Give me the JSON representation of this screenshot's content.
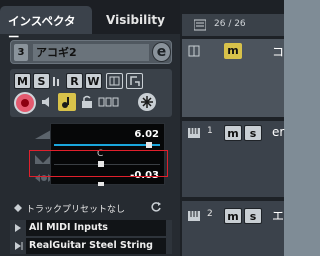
{
  "inspector": {
    "tabs": [
      {
        "label": "インスペクター",
        "active": true
      },
      {
        "label": "Visibility",
        "active": false
      }
    ],
    "track": {
      "number": "3",
      "name": "アコギ2",
      "edit_label": "e"
    },
    "buttons": {
      "mute": "M",
      "solo": "S",
      "read": "R",
      "write": "W"
    },
    "level": {
      "volume_value": "6.02",
      "pan_value": "C",
      "delay_value": "-0.03"
    },
    "preset": {
      "label": "トラックプリセットなし"
    },
    "input": {
      "label": "All MIDI Inputs"
    },
    "output": {
      "label": "RealGuitar Steel String"
    }
  },
  "tracklist": {
    "header": {
      "counter": "26 / 26"
    },
    "tracks": [
      {
        "number": "",
        "mute_label": "m",
        "solo_label": "s",
        "name": "コ"
      },
      {
        "number": "1",
        "mute_label": "m",
        "solo_label": "s",
        "name": "er"
      },
      {
        "number": "2",
        "mute_label": "m",
        "solo_label": "s",
        "name": "エ"
      }
    ]
  },
  "colors": {
    "accent_yellow": "#d8c24a",
    "record_red": "#e45a6f",
    "highlight_red": "#e0202c",
    "panel_dark": "#262b31"
  }
}
